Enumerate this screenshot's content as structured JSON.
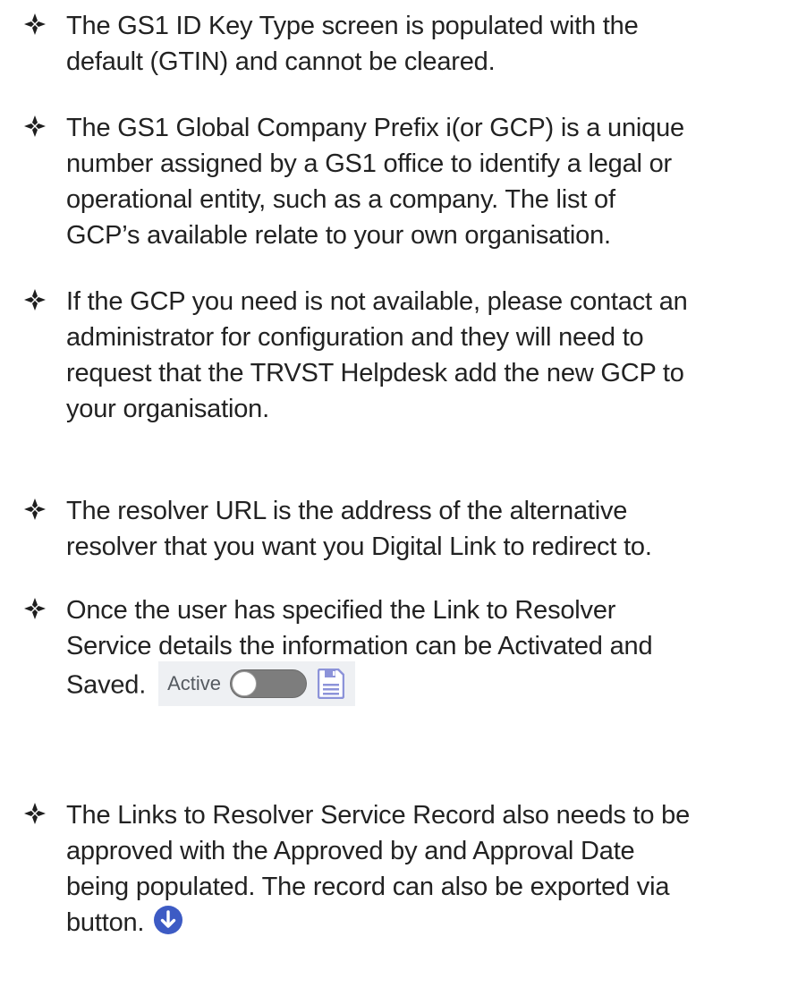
{
  "bullets": [
    {
      "lines": [
        "The GS1 ID Key Type screen is populated with the",
        "default (GTIN) and cannot be cleared."
      ]
    },
    {
      "lines": [
        "The GS1 Global Company Prefix i(or GCP) is a unique",
        "number assigned by a GS1 office to identify a legal or",
        "operational entity, such as a company.  The list of",
        "GCP’s available relate to your own organisation."
      ]
    },
    {
      "lines": [
        "If the GCP you need is not available, please contact an",
        "administrator for configuration and they will need to",
        "request that the TRVST Helpdesk add the new GCP to",
        "your organisation."
      ]
    },
    {
      "lines": [
        "The resolver URL is the address of the alternative",
        "resolver that you want you Digital Link to redirect to."
      ]
    },
    {
      "lines": [
        "Once the user has specified the Link to Resolver",
        "Service details the information can be Activated and",
        "Saved."
      ]
    },
    {
      "lines": [
        "The Links to Resolver Service Record also needs to be",
        "approved with the Approved by and Approval Date",
        "being populated. The record can also be exported via",
        "button."
      ]
    }
  ],
  "active_widget": {
    "label": "Active",
    "toggle_on": false,
    "save_icon": "floppy-disk-icon"
  },
  "export_icon": "download-arrow-icon",
  "colors": {
    "marker": "#1e1e1e",
    "toggle_track": "#7d7d7d",
    "save_icon": "#8c93d9",
    "export_icon": "#3d5bc4"
  }
}
